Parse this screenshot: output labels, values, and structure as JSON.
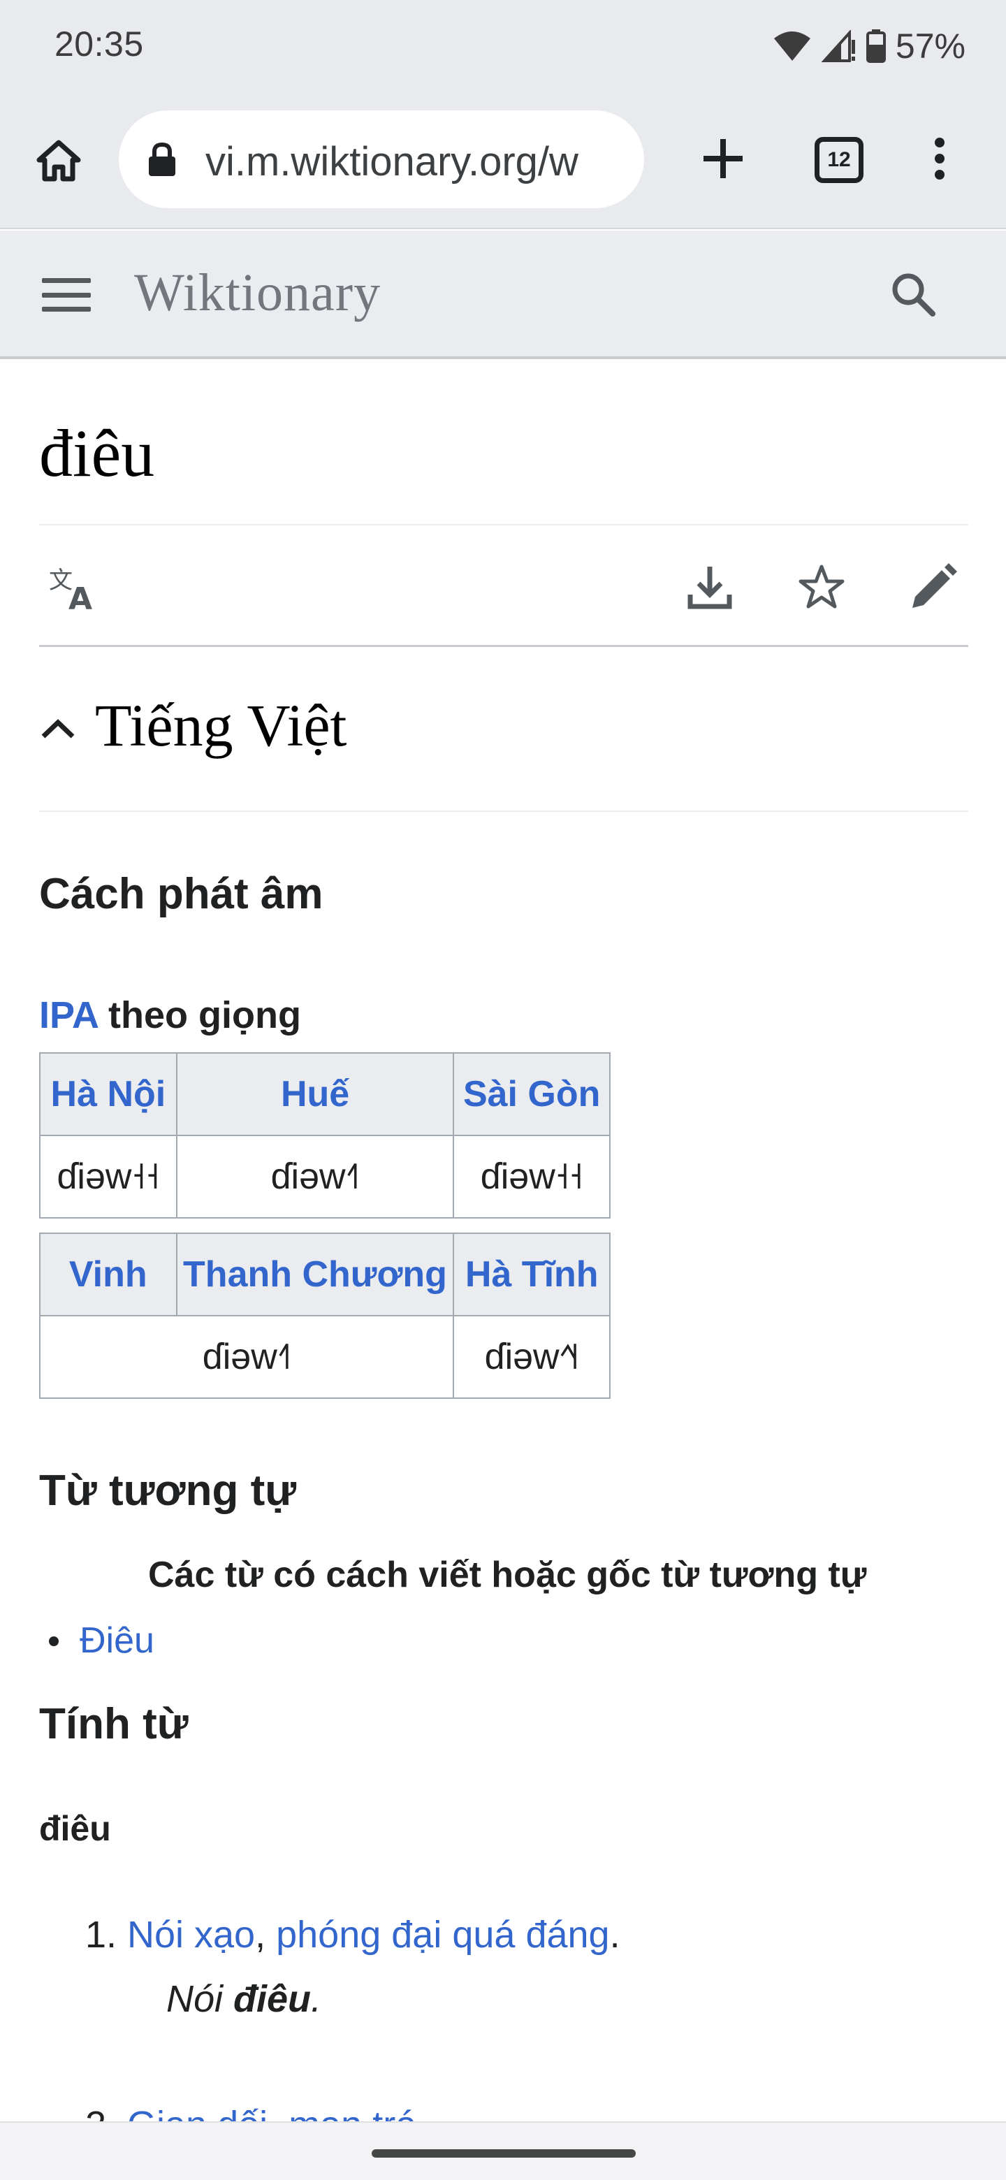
{
  "status_bar": {
    "time": "20:35",
    "battery": "57%"
  },
  "browser": {
    "url": "vi.m.wiktionary.org/w",
    "tab_count": "12",
    "icons": [
      "home-icon",
      "lock-icon",
      "plus-icon",
      "tab-switcher-icon",
      "more-vert-icon"
    ]
  },
  "site": {
    "title": "Wiktionary"
  },
  "page": {
    "title": "điêu",
    "section": "Tiếng Việt",
    "pronunciation": {
      "heading": "Cách phát âm",
      "ipa_link": "IPA",
      "ipa_suffix": " theo giọng",
      "table1": {
        "headers": [
          "Hà Nội",
          "Huế",
          "Sài Gòn"
        ],
        "cells": [
          "ɗiəw˧˧",
          "ɗiəw˧˥",
          "ɗiəw˧˧"
        ]
      },
      "table2": {
        "headers": [
          "Vinh",
          "Thanh Chương",
          "Hà Tĩnh"
        ],
        "cells": [
          "ɗiəw˧˥",
          "ɗiəw˧˥˧"
        ]
      }
    },
    "similar": {
      "heading": "Từ tương tự",
      "caption": "Các từ có cách viết hoặc gốc từ tương tự",
      "items": [
        "Điêu"
      ]
    },
    "adjective": {
      "heading": "Tính từ",
      "headword": "điêu",
      "senses": [
        {
          "link1": "Nói xạo",
          "sep": ", ",
          "link2": "phóng đại quá đáng",
          "end": ".",
          "example_pre": "Nói ",
          "example_bold": "điêu",
          "example_end": "."
        },
        {
          "link1": "Gian dối",
          "sep": ", ",
          "link2": "man trá",
          "end": "."
        }
      ]
    }
  },
  "colors": {
    "link": "#3366cc",
    "header_bg": "#eaecf0",
    "chrome_bg": "#e8eaee"
  }
}
